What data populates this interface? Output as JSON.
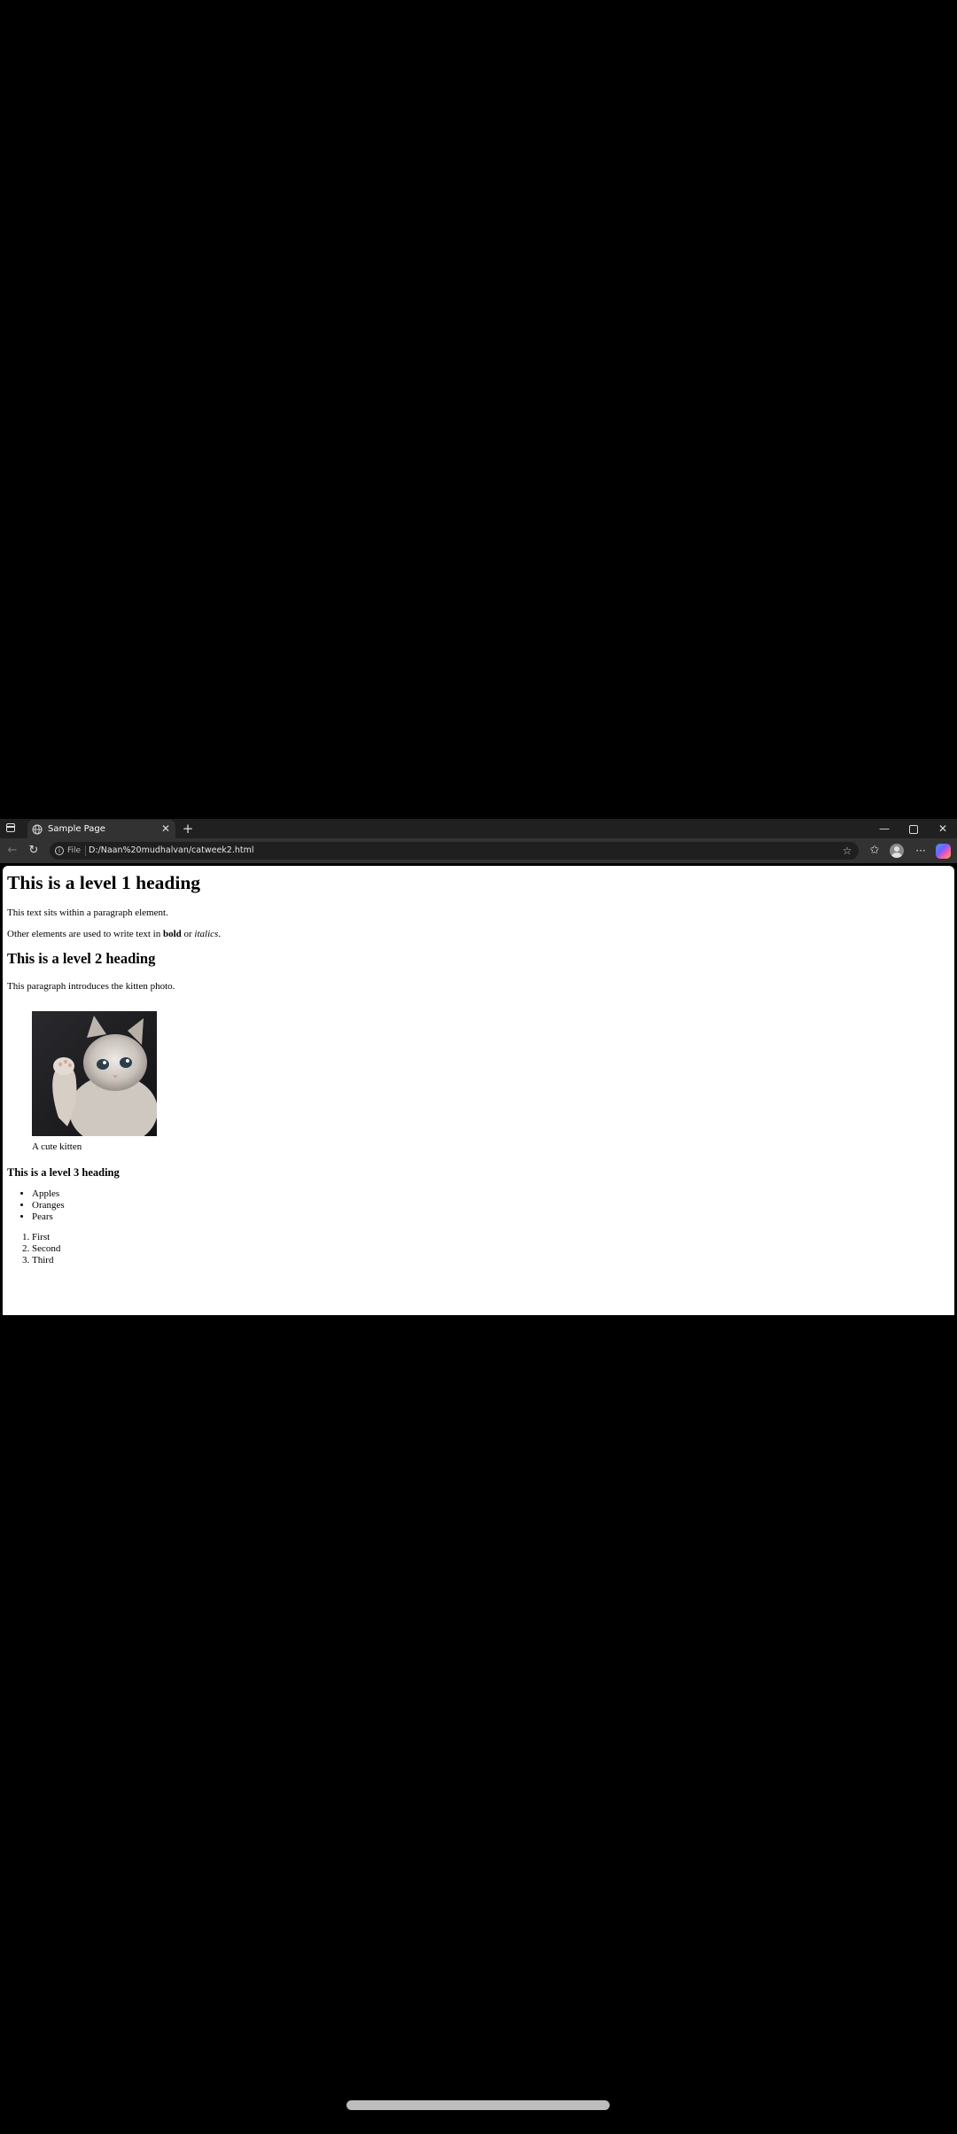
{
  "browser": {
    "tab": {
      "title": "Sample Page"
    },
    "address": {
      "scheme_label": "File",
      "url": "D:/Naan%20mudhalvan/catweek2.html"
    },
    "icons": {
      "tab_actions": "tab-actions-icon",
      "favicon": "globe-icon",
      "close": "close-icon",
      "new_tab": "plus-icon",
      "back": "back-arrow-icon",
      "refresh": "refresh-icon",
      "info": "info-icon",
      "favorite": "star-icon",
      "favorites": "favorites-icon",
      "profile": "profile-icon",
      "more": "more-icon",
      "copilot": "copilot-icon"
    },
    "colors": {
      "titlebar": "#202020",
      "toolbar": "#323232",
      "addressbar": "#1f1f1f"
    }
  },
  "page": {
    "h1": "This is a level 1 heading",
    "p1": "This text sits within a paragraph element.",
    "p2": {
      "before": "Other elements are used to write text in ",
      "bold": "bold",
      "middle": " or ",
      "italic": "italics",
      "after": "."
    },
    "h2": "This is a level 2 heading",
    "p3": "This paragraph introduces the kitten photo.",
    "figcaption": "A cute kitten",
    "h3": "This is a level 3 heading",
    "unordered": [
      "Apples",
      "Oranges",
      "Pears"
    ],
    "ordered": [
      "First",
      "Second",
      "Third"
    ]
  }
}
